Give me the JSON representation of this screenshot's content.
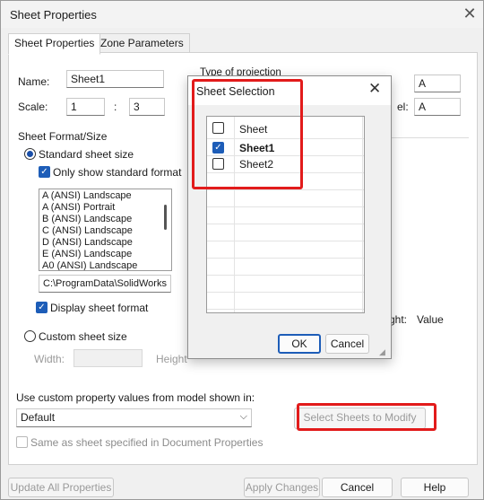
{
  "window": {
    "title": "Sheet Properties"
  },
  "tabs": [
    {
      "label": "Sheet Properties"
    },
    {
      "label": "Zone Parameters"
    }
  ],
  "fields": {
    "name_label": "Name:",
    "name_value": "Sheet1",
    "scale_label": "Scale:",
    "scale_num": "1",
    "scale_sep": ":",
    "scale_den": "3",
    "projection_label": "Type of projection",
    "right_value_1": "A",
    "right_value_2": "A",
    "right_label_2": "el:"
  },
  "sheet_format": {
    "group_label": "Sheet Format/Size",
    "standard_label": "Standard sheet size",
    "only_standard_label": "Only show standard format",
    "formats": [
      "A (ANSI) Landscape",
      "A (ANSI) Portrait",
      "B (ANSI) Landscape",
      "C (ANSI) Landscape",
      "D (ANSI) Landscape",
      "E (ANSI) Landscape",
      "A0 (ANSI) Landscape"
    ],
    "path": "C:\\ProgramData\\SolidWorks",
    "display_format_label": "Display sheet format",
    "custom_label": "Custom sheet size",
    "width_label": "Width:",
    "height_label": "Height",
    "right_height_label": "ght:",
    "right_value_label": "Value"
  },
  "custom_prop": {
    "label": "Use custom property values from model shown in:",
    "selected": "Default",
    "select_sheets_label": "Select Sheets to Modify",
    "same_as_label": "Same as sheet specified in Document Properties"
  },
  "bottom": {
    "update_all": "Update All Properties",
    "apply": "Apply Changes",
    "cancel": "Cancel",
    "help": "Help"
  },
  "dialog": {
    "title": "Sheet Selection",
    "header": "Sheet",
    "rows": [
      {
        "label": "Sheet1",
        "checked": true
      },
      {
        "label": "Sheet2",
        "checked": false
      }
    ],
    "ok": "OK",
    "cancel": "Cancel"
  },
  "colors": {
    "accent": "#1d5db8",
    "highlight": "#e21b1b"
  },
  "icons": {
    "close": "close-icon",
    "dropdown": "chevron-down-icon",
    "check": "checkmark-icon",
    "resize": "resize-grip-icon"
  }
}
